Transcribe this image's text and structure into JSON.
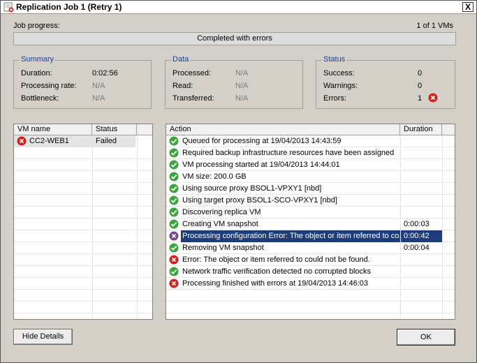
{
  "window": {
    "title": "Replication Job 1 (Retry 1)",
    "close_symbol": "X"
  },
  "progress": {
    "label": "Job progress:",
    "vm_count": "1 of 1 VMs",
    "status_text": "Completed with errors"
  },
  "summary": {
    "title": "Summary",
    "duration_label": "Duration:",
    "duration_value": "0:02:56",
    "rate_label": "Processing rate:",
    "rate_value": "N/A",
    "bottleneck_label": "Bottleneck:",
    "bottleneck_value": "N/A"
  },
  "data_group": {
    "title": "Data",
    "processed_label": "Processed:",
    "processed_value": "N/A",
    "read_label": "Read:",
    "read_value": "N/A",
    "transferred_label": "Transferred:",
    "transferred_value": "N/A"
  },
  "status_group": {
    "title": "Status",
    "success_label": "Success:",
    "success_value": "0",
    "warnings_label": "Warnings:",
    "warnings_value": "0",
    "errors_label": "Errors:",
    "errors_value": "1"
  },
  "vm_table": {
    "col_name": "VM name",
    "col_status": "Status",
    "rows": [
      {
        "name": "CC2-WEB1",
        "status": "Failed",
        "icon": "error-icon"
      }
    ]
  },
  "action_table": {
    "col_action": "Action",
    "col_duration": "Duration",
    "rows": [
      {
        "icon": "success-icon",
        "text": "Queued for processing at 19/04/2013 14:43:59",
        "duration": ""
      },
      {
        "icon": "success-icon",
        "text": "Required backup infrastructure resources have been assigned",
        "duration": ""
      },
      {
        "icon": "success-icon",
        "text": "VM processing started at 19/04/2013 14:44:01",
        "duration": ""
      },
      {
        "icon": "success-icon",
        "text": "VM size: 200.0 GB",
        "duration": ""
      },
      {
        "icon": "success-icon",
        "text": "Using source proxy BSOL1-VPXY1 [nbd]",
        "duration": ""
      },
      {
        "icon": "success-icon",
        "text": "Using target proxy BSOL1-SCO-VPXY1 [nbd]",
        "duration": ""
      },
      {
        "icon": "success-icon",
        "text": "Discovering replica VM",
        "duration": ""
      },
      {
        "icon": "success-icon",
        "text": "Creating VM snapshot",
        "duration": "0:00:03"
      },
      {
        "icon": "error-icon",
        "text": "Processing configuration Error: The object or item referred to co...",
        "duration": "0:00:42"
      },
      {
        "icon": "success-icon",
        "text": "Removing VM snapshot",
        "duration": "0:00:04"
      },
      {
        "icon": "error-icon",
        "text": "Error: The object or item referred to could not be found.",
        "duration": ""
      },
      {
        "icon": "success-icon",
        "text": "Network traffic verification detected no corrupted blocks",
        "duration": ""
      },
      {
        "icon": "error-icon",
        "text": "Processing finished with errors at 19/04/2013 14:46:03",
        "duration": ""
      }
    ]
  },
  "buttons": {
    "hide_details": "Hide Details",
    "ok": "OK"
  },
  "colors": {
    "success": "#3aa63a",
    "error": "#d42020",
    "selected_row": "#1e3c7a",
    "group_title": "#1c3ea0"
  }
}
